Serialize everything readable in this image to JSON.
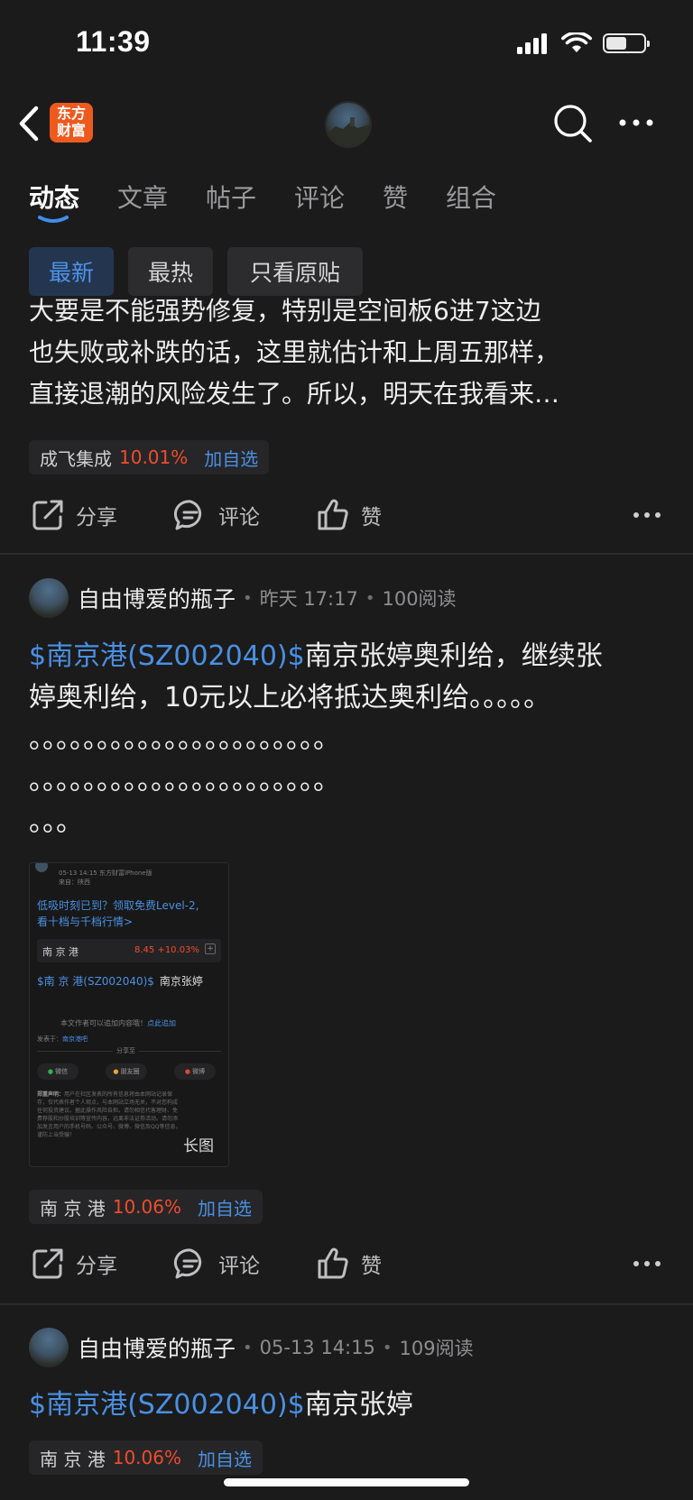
{
  "status_bar": {
    "time": "11:39",
    "battery_level": 0.55
  },
  "nav": {
    "back_icon": "chevron-left-icon",
    "logo_line1": "东方",
    "logo_line2": "财富",
    "search_icon": "search-icon",
    "more_icon": "more-horizontal-icon"
  },
  "tabs": [
    {
      "label": "动态"
    },
    {
      "label": "文章"
    },
    {
      "label": "帖子"
    },
    {
      "label": "评论"
    },
    {
      "label": "赞"
    },
    {
      "label": "组合"
    }
  ],
  "filters": [
    {
      "label": "最新"
    },
    {
      "label": "最热"
    },
    {
      "label": "只看原贴"
    }
  ],
  "colors": {
    "accent": "#4a90e2",
    "rise": "#f04c2c",
    "logo": "#ee5a1e",
    "background": "#1b1b1c"
  },
  "posts": [
    {
      "text_line1": "大要是不能强势修复，特别是空间板6进7这边",
      "text_line2": "也失败或补跌的话，这里就估计和上周五那样，",
      "text_line3": "直接退潮的风险发生了。所以，明天在我看来…",
      "stock": {
        "name": "成飞集成",
        "change": "10.01%",
        "add_label": "加自选"
      },
      "actions": {
        "share": "分享",
        "comment": "评论",
        "like": "赞"
      }
    },
    {
      "author": "自由博爱的瓶子",
      "time": "昨天 17:17",
      "reads": "100阅读",
      "link_text": "$南京港(SZ002040)$",
      "text_line1_rest": "南京张婷奥利给，继续张",
      "text_line2": "婷奥利给，10元以上必将抵达奥利给。。。。。",
      "text_line3": "。。。。。。。。。。。。。。。。。。。。。。",
      "text_line4": "。。。。。。。。。。。。。。。。。。。。。。",
      "text_line5": "。。。",
      "image": {
        "label": "长图",
        "top_meta": "05-13 14:15 东方财富iPhone版",
        "location": "来自：陕西",
        "promo_line1": "低吸时刻已到？领取免费Level-2,",
        "promo_line2": "看十档与千档行情>",
        "stock_name": "南 京 港",
        "stock_quote": "8.45  +10.03%",
        "post_link": "$南 京 港(SZ002040)$",
        "post_rest": "南京张婷",
        "append_note": "本文作者可以追加内容哦！",
        "append_link": "点此追加",
        "share_title": "分享至",
        "share_wechat": "微信",
        "share_circle": "朋友圈",
        "share_weibo": "微博",
        "disclaimer_title": "郑重声明：",
        "disclaimer_text": "用户在社区发表的所有信息将由本网站记录保存，仅代表作者个人观点，与本网站立场无关，不对您构成任何投资建议。据此操作风险自担。请勿相信代客理财、免费荐股和炒股培训等宣传内容，远离非法证券活动。请勿添加发言用户的手机号码、公众号、微博、微信及QQ等信息，谨防上当受骗！"
      },
      "stock": {
        "name": "南 京 港",
        "change": "10.06%",
        "add_label": "加自选"
      },
      "actions": {
        "share": "分享",
        "comment": "评论",
        "like": "赞"
      }
    },
    {
      "author": "自由博爱的瓶子",
      "time": "05-13 14:15",
      "reads": "109阅读",
      "link_text": "$南京港(SZ002040)$",
      "text_rest": "南京张婷",
      "stock": {
        "name": "南 京 港",
        "change": "10.06%",
        "add_label": "加自选"
      }
    }
  ]
}
